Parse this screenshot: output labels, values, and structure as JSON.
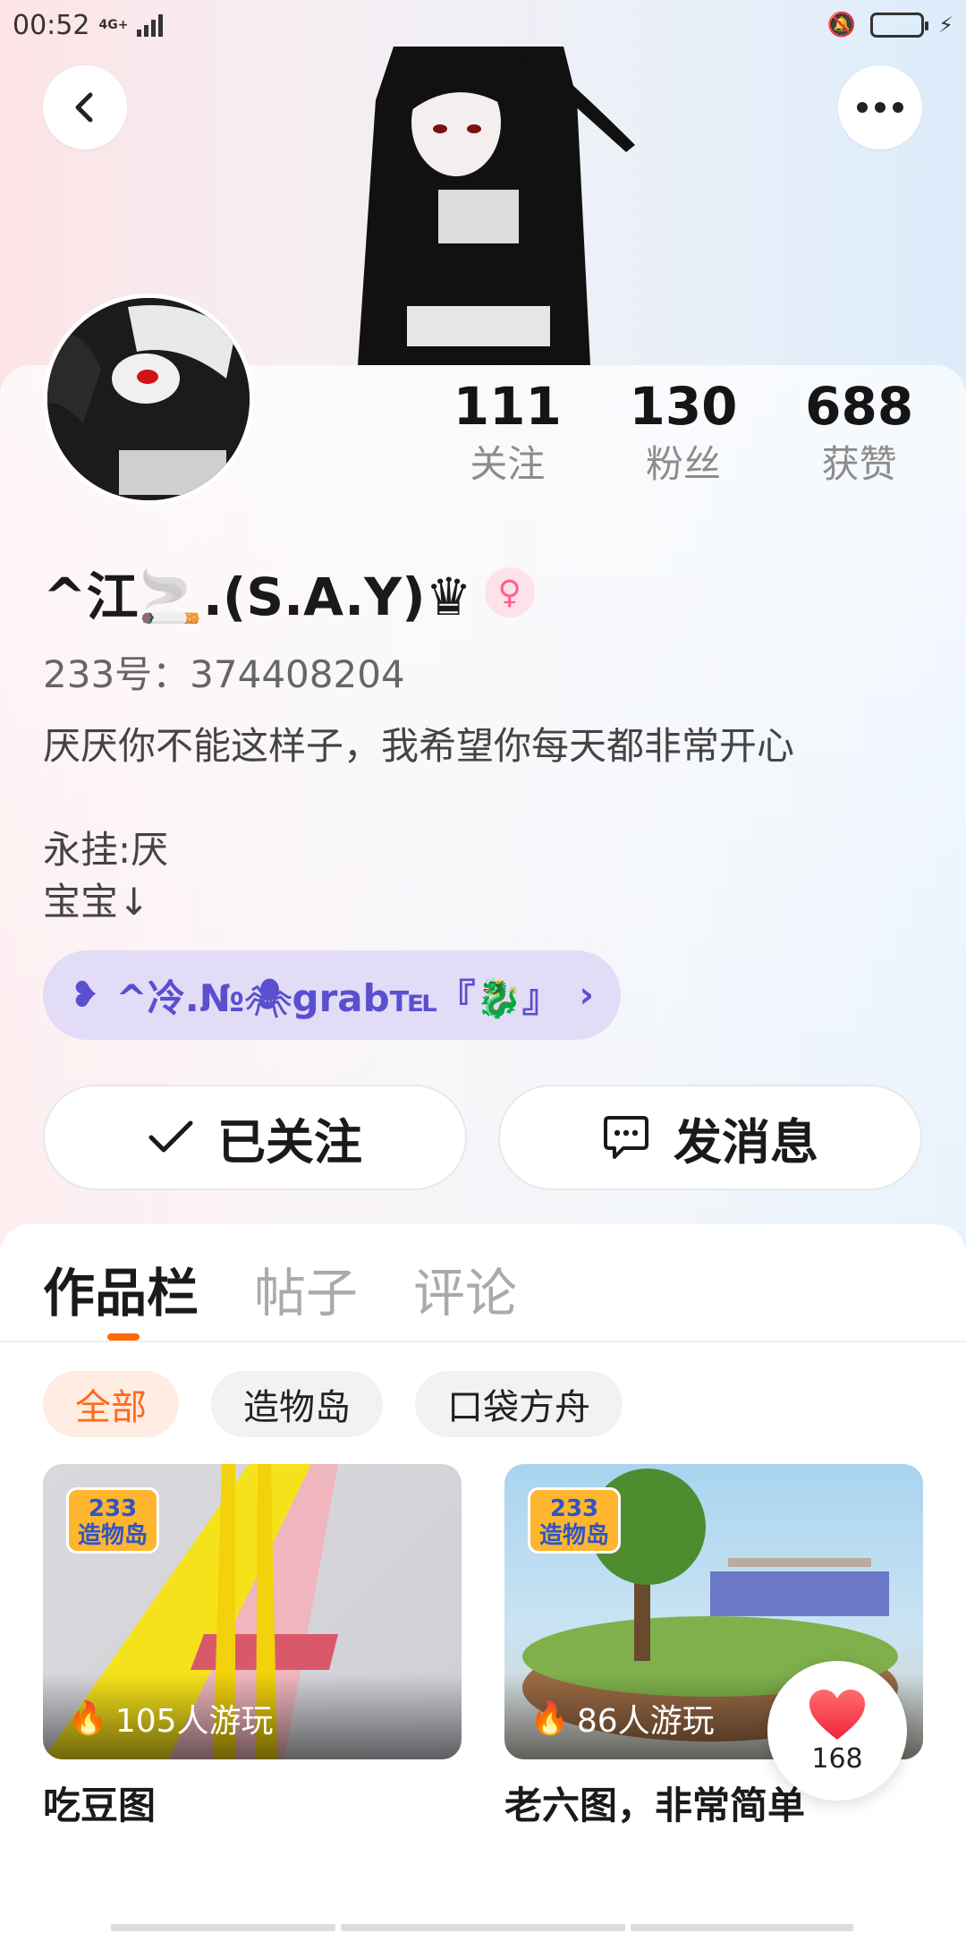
{
  "status_bar": {
    "time": "00:52",
    "network": "4G+"
  },
  "header": {
    "back_icon": "chevron-left-icon",
    "more_icon": "more-horizontal-icon"
  },
  "profile": {
    "nickname": "^江🚬.(S.A.Y)♛",
    "gender_symbol": "♀",
    "user_id": "233号：374408204",
    "bio": "厌厌你不能这样子，我希望你每天都非常开心\n\n永挂:厌\n宝宝↓",
    "stats": [
      {
        "value": "111",
        "label": "关注"
      },
      {
        "value": "130",
        "label": "粉丝"
      },
      {
        "value": "688",
        "label": "获赞"
      }
    ],
    "clan": {
      "label": "^冷.№🕷grab℡『🐉』",
      "icon": "hearts-icon"
    }
  },
  "actions": {
    "follow_label": "已关注",
    "message_label": "发消息"
  },
  "tabs": [
    {
      "label": "作品栏",
      "active": true
    },
    {
      "label": "帖子",
      "active": false
    },
    {
      "label": "评论",
      "active": false
    }
  ],
  "filters": [
    {
      "label": "全部",
      "active": true
    },
    {
      "label": "造物岛",
      "active": false
    },
    {
      "label": "口袋方舟",
      "active": false
    }
  ],
  "works": [
    {
      "badge_line1": "233",
      "badge_line2": "造物岛",
      "plays": "105人游玩",
      "title": "吃豆图"
    },
    {
      "badge_line1": "233",
      "badge_line2": "造物岛",
      "plays": "86人游玩",
      "title": "老六图，非常简单"
    }
  ],
  "like_button": {
    "count": "168",
    "icon": "heart-icon"
  },
  "colors": {
    "accent": "#ff6a00",
    "clan_bg": "#e2dcf7",
    "clan_text": "#5a4fcf"
  }
}
